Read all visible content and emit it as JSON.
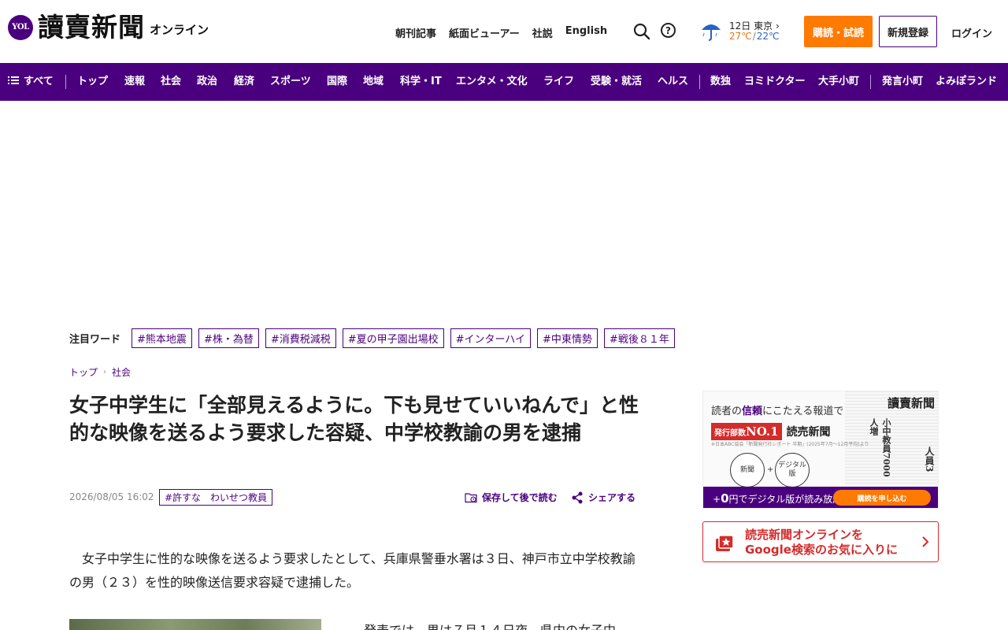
{
  "header": {
    "logo_badge": "YOL",
    "logo_text": "讀賣新聞",
    "logo_sub": "オンライン",
    "nav": [
      "朝刊記事",
      "紙面ビューアー",
      "社説",
      "English"
    ],
    "weather": {
      "date": "12日",
      "city": "東京",
      "high": "27℃",
      "slash": "/",
      "low": "22℃",
      "icon": "umbrella-rain-icon"
    },
    "subscribe_label": "購読・試読",
    "register_label": "新規登録",
    "login_label": "ログイン"
  },
  "navbar": {
    "all_label": "すべて",
    "items": [
      "トップ",
      "速報",
      "社会",
      "政治",
      "経済",
      "スポーツ",
      "国際",
      "地域",
      "科学・IT",
      "エンタメ・文化",
      "ライフ",
      "受験・就活",
      "ヘルス",
      "数独",
      "ヨミドクター",
      "大手小町",
      "発言小町",
      "よみぽランド"
    ]
  },
  "trend": {
    "label": "注目ワード",
    "tags": [
      "#熊本地震",
      "#株・為替",
      "#消費税減税",
      "#夏の甲子園出場校",
      "#インターハイ",
      "#中東情勢",
      "#戦後８１年"
    ]
  },
  "breadcrumb": [
    "トップ",
    "社会"
  ],
  "article": {
    "title": "女子中学生に「全部見えるように。下も見せていいねんで」と性的な映像を送るよう要求した容疑、中学校教諭の男を逮捕",
    "date": "2026/08/05 16:02",
    "tag": "#許すな　わいせつ教員",
    "save_label": "保存して後で読む",
    "share_label": "シェアする",
    "lead": "　女子中学生に性的な映像を送るよう要求したとして、兵庫県警垂水署は３日、神戸市立中学校教諭の男（２３）を性的映像送信要求容疑で逮捕した。",
    "para2": "　発表では、男は７月１４日夜、県内の女子中"
  },
  "sidebar": {
    "ad": {
      "catch_pre": "読者の",
      "catch_bold": "信頼",
      "catch_post": "にこたえる報道で",
      "no1_pre": "発行部数",
      "no1_big": "NO.1",
      "yomiuri": "読売新聞",
      "fine": "※日本ABC協会「新聞発行社レポート 半期」(2025年7月〜12月平均)より",
      "paper_title": "讀賣新聞",
      "paper_head": "小中教員7000人増",
      "paper_head2": "人員3",
      "circle1": "新聞",
      "circle2": "デジタル版",
      "plus": "+",
      "bar_pre": "+",
      "bar_big": "0",
      "bar_post": "円でデジタル版が読み放題!",
      "bar_btn": "購読を申し込む"
    },
    "google": {
      "line1": "読売新聞オンラインを",
      "line2": "Google検索のお気に入りに"
    }
  }
}
